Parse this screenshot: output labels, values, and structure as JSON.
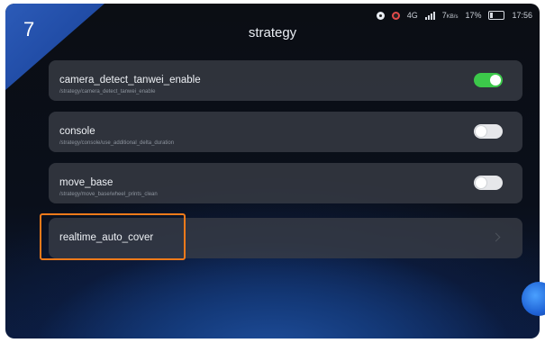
{
  "step_number": "7",
  "header": {
    "title": "strategy"
  },
  "status_bar": {
    "signal_text": "4G",
    "speed": "7",
    "speed_unit": "KB/s",
    "battery": "17%",
    "time": "17:56"
  },
  "items": [
    {
      "name": "camera_detect_tanwei_enable",
      "path": "/strategy/camera_detect_tanwei_enable",
      "toggle": "on"
    },
    {
      "name": "console",
      "path": "/strategy/console/use_additional_delta_duration",
      "toggle": "off"
    },
    {
      "name": "move_base",
      "path": "/strategy/move_base/wheel_prints_clean",
      "toggle": "off"
    },
    {
      "name": "realtime_auto_cover",
      "path": "",
      "toggle": "none"
    }
  ],
  "colors": {
    "highlight": "#f07a1a",
    "toggle_on": "#3cc84a",
    "corner_tab": "#2c5bb8"
  },
  "icons": [
    "notification-icon",
    "record-icon",
    "signal-icon",
    "battery-icon",
    "chevron-right-icon"
  ]
}
